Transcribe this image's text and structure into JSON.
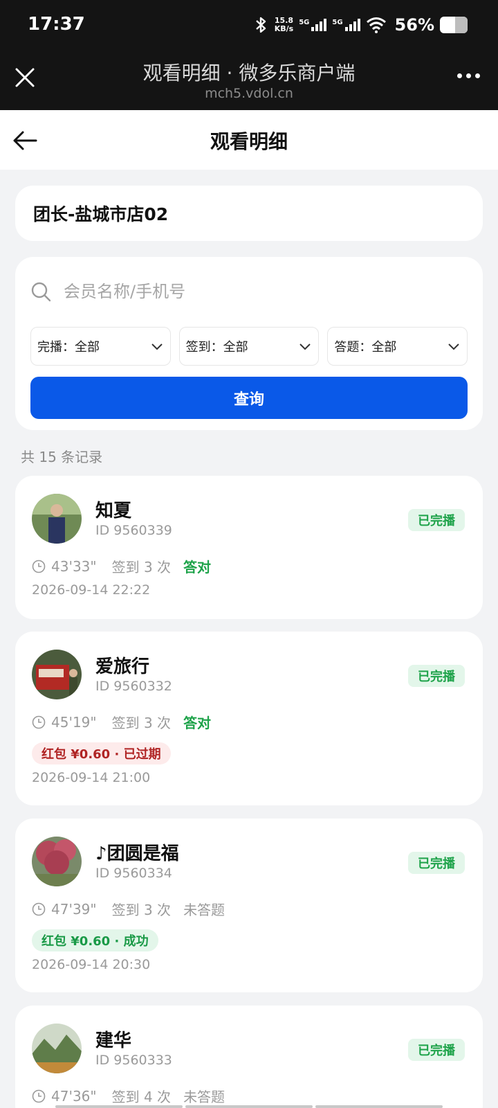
{
  "status_bar": {
    "time": "17:37",
    "net_speed_value": "15.8",
    "net_speed_unit": "KB/s",
    "net_label_1": "5G",
    "net_label_2": "5G",
    "battery": "56%",
    "battery_level": 0.56
  },
  "wechat_bar": {
    "title": "观看明细 · 微多乐商户端",
    "domain": "mch5.vdol.cn"
  },
  "nav": {
    "title": "观看明细"
  },
  "store": {
    "name": "团长-盐城市店02"
  },
  "filters": {
    "search_placeholder": "会员名称/手机号",
    "selects": [
      {
        "label": "完播：全部"
      },
      {
        "label": "签到：全部"
      },
      {
        "label": "答题：全部"
      }
    ],
    "query_label": "查询"
  },
  "record_count": "共 15 条记录",
  "members": [
    {
      "name": "知夏",
      "id": "ID 9560339",
      "status": "已完播",
      "duration": "43'33\"",
      "sign": "签到 3 次",
      "answer": "答对",
      "time": "2026-09-14 22:22"
    },
    {
      "name": "爱旅行",
      "id": "ID 9560332",
      "status": "已完播",
      "duration": "45'19\"",
      "sign": "签到 3 次",
      "answer": "答对",
      "red_packet": "红包 ¥0.60 · 已过期",
      "time": "2026-09-14 21:00"
    },
    {
      "name": "♪团圆是福",
      "id": "ID 9560334",
      "status": "已完播",
      "duration": "47'39\"",
      "sign": "签到 3 次",
      "answer": "未答题",
      "red_packet": "红包 ¥0.60 · 成功",
      "time": "2026-09-14 20:30"
    },
    {
      "name": "建华",
      "id": "ID 9560333",
      "status": "已完播",
      "duration": "47'36\"",
      "sign": "签到 4 次",
      "answer": "未答题"
    }
  ],
  "colors": {
    "primary": "#0a59e8",
    "success": "#1ea34a",
    "danger": "#b02424"
  }
}
